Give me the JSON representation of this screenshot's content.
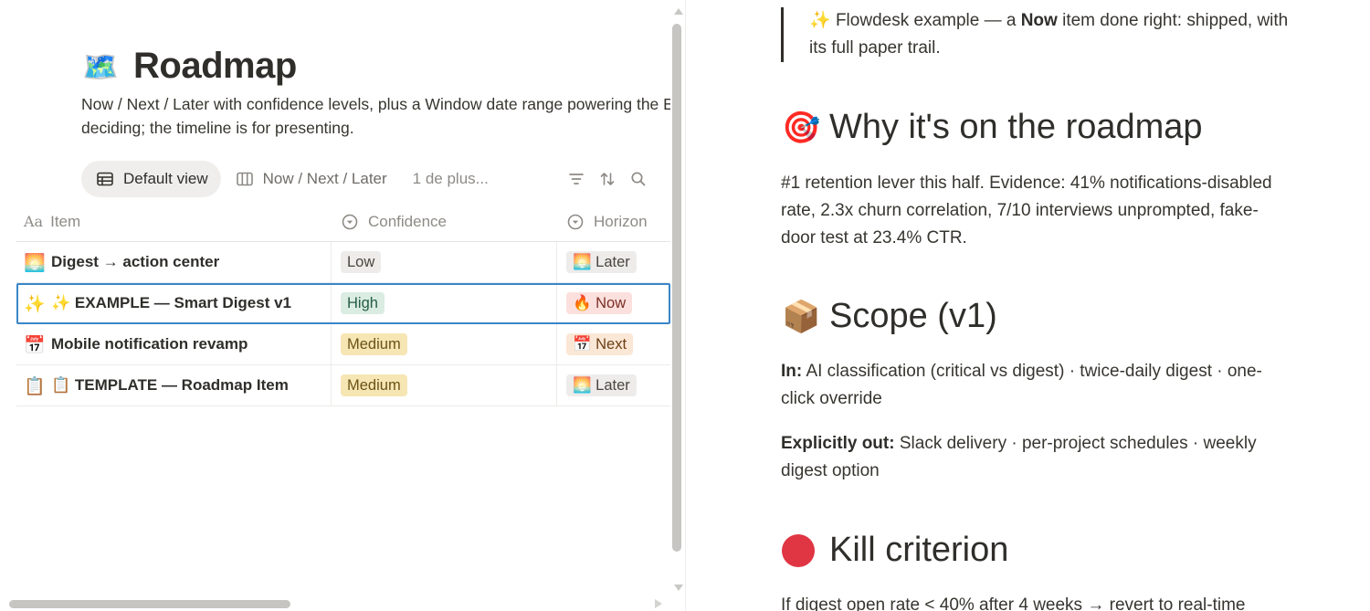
{
  "left": {
    "page_emoji": "🗺️",
    "title": "Roadmap",
    "description_line1": "Now / Next / Later with confidence levels, plus a Window date range powering the Exe",
    "description_line2": "deciding; the timeline is for presenting.",
    "views": {
      "default_label": "Default view",
      "second_label": "Now / Next / Later",
      "more_label": "1 de plus..."
    },
    "table": {
      "headers": {
        "item": "Item",
        "item_prefix": "Aa",
        "confidence": "Confidence",
        "horizon": "Horizon"
      },
      "rows": [
        {
          "emoji": "🌅",
          "title": "Digest → action center",
          "confidence": "Low",
          "horizon_emoji": "🌅",
          "horizon": "Later"
        },
        {
          "emoji": "✨",
          "title": "✨ EXAMPLE — Smart Digest v1",
          "confidence": "High",
          "horizon_emoji": "🔥",
          "horizon": "Now"
        },
        {
          "emoji": "📅",
          "title": "Mobile notification revamp",
          "confidence": "Medium",
          "horizon_emoji": "📅",
          "horizon": "Next"
        },
        {
          "emoji": "📋",
          "title": "📋 TEMPLATE — Roadmap Item",
          "confidence": "Medium",
          "horizon_emoji": "🌅",
          "horizon": "Later"
        }
      ]
    }
  },
  "right": {
    "callout_emoji": "✨",
    "callout_pre": "Flowdesk example — a ",
    "callout_bold": "Now",
    "callout_post": " item done right: shipped, with its full paper trail.",
    "section1": {
      "emoji": "🎯",
      "heading": "Why it's on the roadmap"
    },
    "section1_text": "#1 retention lever this half. Evidence: 41% notifications-disabled rate, 2.3x churn correlation, 7/10 interviews unprompted, fake-door test at 23.4% CTR.",
    "section2": {
      "emoji": "📦",
      "heading": "Scope (v1)"
    },
    "scope_in_label": "In:",
    "scope_in_text": " AI classification (critical vs digest) · twice-daily digest · one-click override",
    "scope_out_label": "Explicitly out:",
    "scope_out_text": " Slack delivery · per-project schedules · weekly digest option",
    "section3": {
      "heading": "Kill criterion"
    },
    "section3_text": "If digest open rate < 40% after 4 weeks → revert to real-time"
  },
  "colors": {
    "selected_outline": "#3a86c8",
    "high": "#dbece3",
    "medium": "#f6e6b4",
    "now": "#fbe0dd",
    "next": "#fbe7d6",
    "kill_dot": "#e03543"
  }
}
